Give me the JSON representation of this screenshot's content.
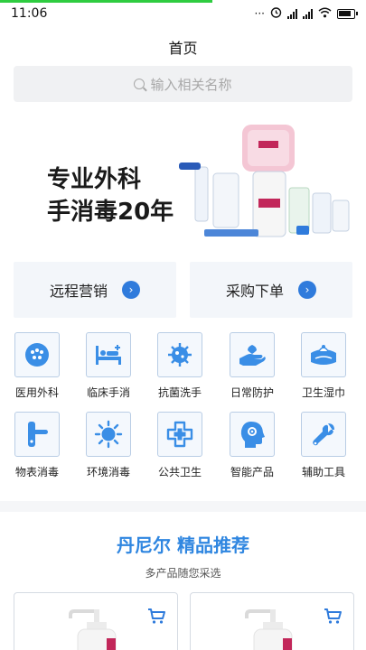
{
  "status_bar": {
    "time": "11:06",
    "load_progress": 0.58,
    "icons": [
      "ellipsis-icon",
      "alarm-icon",
      "signal-icon",
      "signal-icon",
      "wifi-icon",
      "battery-icon"
    ]
  },
  "page_title": "首页",
  "search": {
    "placeholder": "输入相关名称",
    "icon": "search-icon"
  },
  "banner": {
    "line1": "专业外科",
    "line2": "手消毒20年"
  },
  "quick_actions": [
    {
      "label": "远程营销",
      "icon": "chevron-right-icon"
    },
    {
      "label": "采购下单",
      "icon": "chevron-right-icon"
    }
  ],
  "categories": [
    {
      "label": "医用外科",
      "icon": "surgical-icon"
    },
    {
      "label": "临床手消",
      "icon": "hospital-bed-icon"
    },
    {
      "label": "抗菌洗手",
      "icon": "germ-icon"
    },
    {
      "label": "日常防护",
      "icon": "hand-protect-icon"
    },
    {
      "label": "卫生湿巾",
      "icon": "wipes-icon"
    },
    {
      "label": "物表消毒",
      "icon": "door-handle-icon"
    },
    {
      "label": "环境消毒",
      "icon": "sun-icon"
    },
    {
      "label": "公共卫生",
      "icon": "medical-cross-icon"
    },
    {
      "label": "智能产品",
      "icon": "smart-head-icon"
    },
    {
      "label": "辅助工具",
      "icon": "wrench-icon"
    }
  ],
  "recommend": {
    "title": "丹尼尔 精品推荐",
    "subtitle": "多产品随您采选"
  },
  "colors": {
    "accent": "#2f7bdc",
    "title_blue": "#2f86e0",
    "icon_blue": "#3a8ee6"
  }
}
